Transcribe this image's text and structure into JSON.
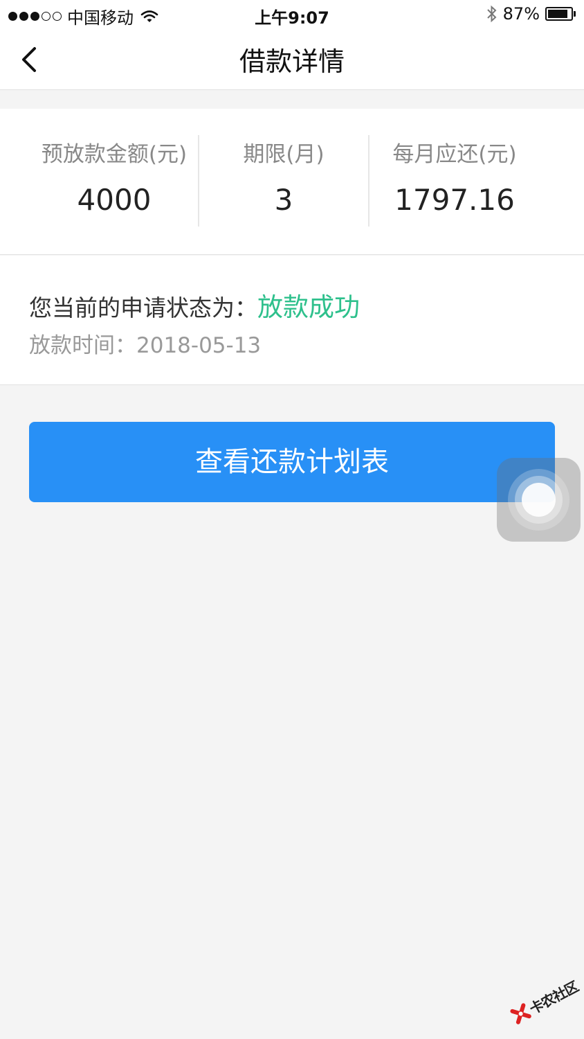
{
  "status_bar": {
    "carrier": "中国移动",
    "time": "上午9:07",
    "battery_percent_text": "87%",
    "battery_level": 0.87,
    "signal_bars_filled": 3,
    "signal_bars_total": 5
  },
  "nav": {
    "title": "借款详情"
  },
  "summary": {
    "items": [
      {
        "label": "预放款金额(元)",
        "value": "4000"
      },
      {
        "label": "期限(月)",
        "value": "3"
      },
      {
        "label": "每月应还(元)",
        "value": "1797.16"
      }
    ]
  },
  "status": {
    "prefix": "您当前的申请状态为：",
    "value": "放款成功",
    "value_color": "#2ec08c",
    "time_label": "放款时间：",
    "time_value": "2018-05-13"
  },
  "action": {
    "button_label": "查看还款计划表",
    "button_color": "#2890f6"
  },
  "watermark": {
    "text": "卡农社区"
  }
}
